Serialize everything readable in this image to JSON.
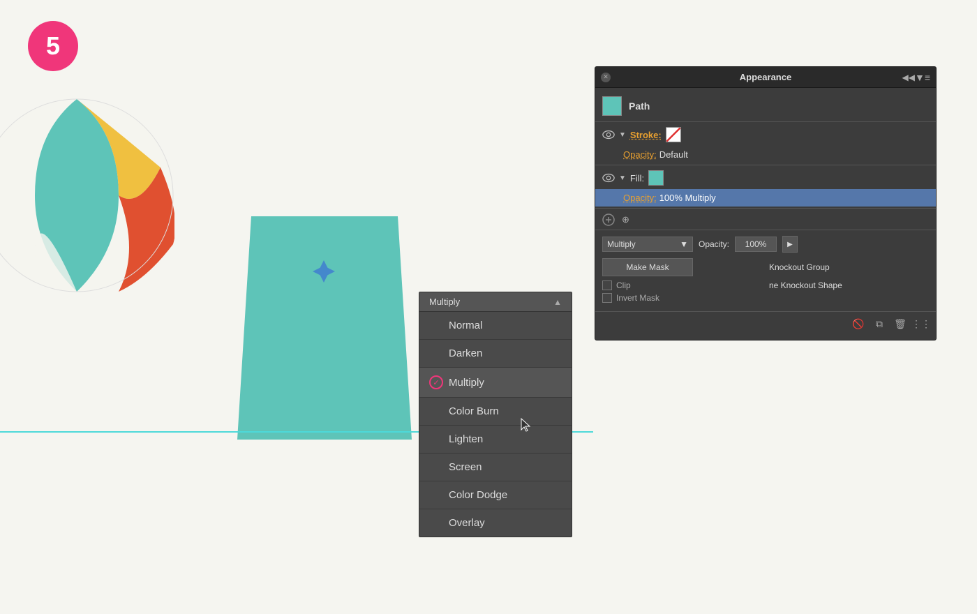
{
  "step": {
    "number": "5"
  },
  "appearance_panel": {
    "title": "Appearance",
    "path_label": "Path",
    "stroke_label": "Stroke:",
    "opacity_label": "Opacity:",
    "default_value": "Default",
    "fill_label": "Fill:",
    "opacity_100_multiply": "100% Multiply",
    "make_mask_btn": "Make Mask",
    "clip_label": "Clip",
    "invert_mask_label": "Invert Mask",
    "knockout_group_label": "Knockout Group",
    "is_knockout_shape_label": "ne Knockout Shape",
    "ault_label": "ault"
  },
  "blend_dropdown": {
    "current_value": "Multiply",
    "opacity_value": "100%",
    "items": [
      {
        "id": "normal",
        "label": "Normal",
        "selected": false
      },
      {
        "id": "darken",
        "label": "Darken",
        "selected": false
      },
      {
        "id": "multiply",
        "label": "Multiply",
        "selected": true
      },
      {
        "id": "color-burn",
        "label": "Color Burn",
        "selected": false
      },
      {
        "id": "lighten",
        "label": "Lighten",
        "selected": false
      },
      {
        "id": "screen",
        "label": "Screen",
        "selected": false
      },
      {
        "id": "color-dodge",
        "label": "Color Dodge",
        "selected": false
      },
      {
        "id": "overlay",
        "label": "Overlay",
        "selected": false
      }
    ]
  },
  "icons": {
    "eye": "👁",
    "close": "✕",
    "menu": "≡",
    "collapse": "◀◀",
    "triangle_down": "▼",
    "triangle_right": "▶",
    "no_entry": "🚫",
    "copy": "⧉",
    "trash": "🗑",
    "add": "⊕",
    "check": "✓",
    "play": "▶"
  }
}
